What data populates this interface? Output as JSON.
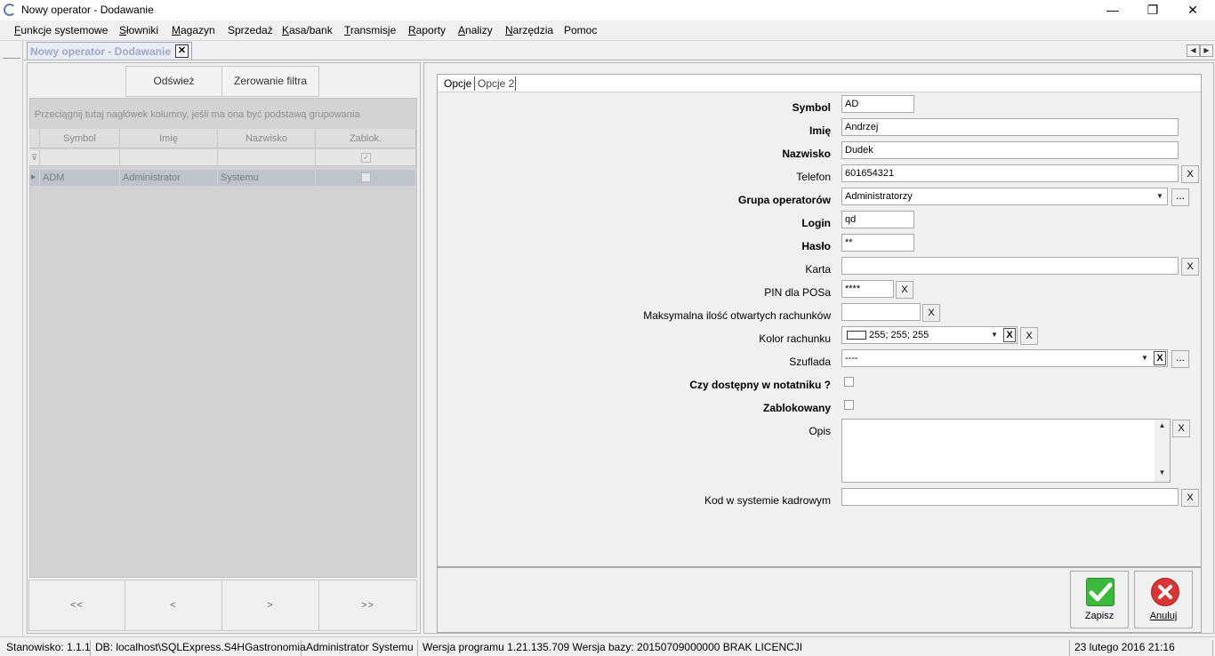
{
  "window": {
    "title": "Nowy operator - Dodawanie",
    "minimize_glyph": "—",
    "maximize_glyph": "❐",
    "close_glyph": "✕"
  },
  "menu": {
    "items": [
      {
        "u": "F",
        "rest": "unkcje systemowe"
      },
      {
        "u": "S",
        "rest": "łowniki"
      },
      {
        "u": "M",
        "rest": "agazyn"
      },
      {
        "u": "",
        "rest": "Sprzedaż"
      },
      {
        "u": "K",
        "rest": "asa/bank"
      },
      {
        "u": "T",
        "rest": "ransmisje"
      },
      {
        "u": "R",
        "rest": "aporty"
      },
      {
        "u": "A",
        "rest": "nalizy"
      },
      {
        "u": "N",
        "rest": "arzędzia"
      },
      {
        "u": "",
        "rest": "Pomoc"
      }
    ]
  },
  "doc_tab": {
    "label": "Nowy operator - Dodawanie",
    "close": "✕"
  },
  "nav": {
    "left": "◀",
    "right": "▶"
  },
  "left": {
    "toolbar": {
      "refresh": "Odśwież",
      "reset_filter": "Zerowanie filtra"
    },
    "grid": {
      "group_hint": "Przeciągnij tutaj nagłówek kolumny, jeśli ma ona być podstawą grupowania",
      "columns": [
        "Symbol",
        "Imię",
        "Nazwisko",
        "Zablok."
      ],
      "filter_icon": "⊽",
      "row_indicator": "▶",
      "rows": [
        {
          "symbol": "ADM",
          "imie": "Administrator",
          "nazwisko": "Systemu",
          "zablok": false
        }
      ]
    },
    "pager": {
      "first": "<<",
      "prev": "<",
      "next": ">",
      "last": ">>"
    }
  },
  "form": {
    "tabs": [
      "Opcje",
      "Opcje 2"
    ],
    "fields": {
      "symbol": {
        "label": "Symbol",
        "value": "AD"
      },
      "imie": {
        "label": "Imię",
        "value": "Andrzej"
      },
      "nazwisko": {
        "label": "Nazwisko",
        "value": "Dudek"
      },
      "telefon": {
        "label": "Telefon",
        "value": "601654321"
      },
      "grupa": {
        "label": "Grupa operatorów",
        "value": "Administratorzy"
      },
      "login": {
        "label": "Login",
        "value": "qd"
      },
      "haslo": {
        "label": "Hasło",
        "value": "**"
      },
      "karta": {
        "label": "Karta",
        "value": ""
      },
      "pin": {
        "label": "PIN dla POSa",
        "value": "****"
      },
      "max_rach": {
        "label": "Maksymalna ilość otwartych rachunków",
        "value": ""
      },
      "kolor": {
        "label": "Kolor rachunku",
        "value": "255; 255; 255"
      },
      "szuflada": {
        "label": "Szuflada",
        "value": "----"
      },
      "notatnik": {
        "label": "Czy dostępny w notatniku ?",
        "checked": false
      },
      "zablokowany": {
        "label": "Zablokowany",
        "checked": false
      },
      "opis": {
        "label": "Opis",
        "value": ""
      },
      "kod": {
        "label": "Kod w systemie kadrowym",
        "value": ""
      }
    },
    "clear_glyph": "X",
    "dots_glyph": "...",
    "dropdown_glyph": "▼",
    "scroll_up": "▲",
    "scroll_down": "▼"
  },
  "actions": {
    "save": "Zapisz",
    "cancel": "Anuluj"
  },
  "status": {
    "station": "Stanowisko: 1.1.1",
    "db": "DB: localhost\\SQLExpress.S4HGastronomia",
    "user": "Administrator Systemu",
    "version": "Wersja programu 1.21.135.709 Wersja bazy: 20150709000000 BRAK LICENCJI",
    "datetime": "23 lutego 2016  21:16"
  },
  "colors": {
    "save_green": "#3cb83c",
    "cancel_red": "#d93535"
  }
}
